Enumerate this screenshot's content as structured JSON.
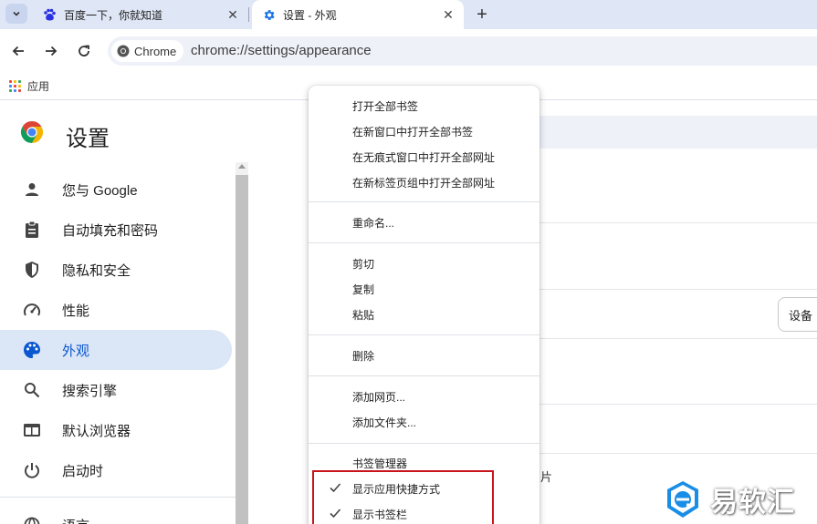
{
  "tabs": [
    {
      "title": "百度一下，你就知道",
      "icon": "baidu-paw-icon"
    },
    {
      "title": "设置 - 外观",
      "icon": "gear-icon"
    }
  ],
  "toolbar": {
    "chip_label": "Chrome",
    "url": "chrome://settings/appearance"
  },
  "bookmarks_bar": {
    "apps_label": "应用"
  },
  "settings": {
    "title": "设置",
    "nav": [
      {
        "label": "您与 Google",
        "icon": "person-icon"
      },
      {
        "label": "自动填充和密码",
        "icon": "clipboard-icon"
      },
      {
        "label": "隐私和安全",
        "icon": "shield-icon"
      },
      {
        "label": "性能",
        "icon": "speedometer-icon"
      },
      {
        "label": "外观",
        "icon": "palette-icon",
        "active": true
      },
      {
        "label": "搜索引擎",
        "icon": "search-icon"
      },
      {
        "label": "默认浏览器",
        "icon": "browser-window-icon"
      },
      {
        "label": "启动时",
        "icon": "power-icon"
      },
      {
        "label": "语言",
        "icon": "globe-icon"
      }
    ],
    "content_button": "设备",
    "content_fragment": "片"
  },
  "context_menu": {
    "groups": [
      [
        "打开全部书签",
        "在新窗口中打开全部书签",
        "在无痕式窗口中打开全部网址",
        "在新标签页组中打开全部网址"
      ],
      [
        "重命名..."
      ],
      [
        "剪切",
        "复制",
        "粘贴"
      ],
      [
        "删除"
      ],
      [
        "添加网页...",
        "添加文件夹..."
      ],
      [
        "书签管理器",
        "显示应用快捷方式",
        "显示书签栏"
      ]
    ],
    "checked_items": [
      "显示应用快捷方式",
      "显示书签栏"
    ]
  },
  "watermark": {
    "text": "易软汇"
  },
  "colors": {
    "tab_strip": "#dfe6f5",
    "active_nav_bg": "#dbe6f7",
    "active_nav_text": "#0b57d0",
    "highlight_box": "#c8151c",
    "watermark_blue": "#1a8ee6"
  }
}
